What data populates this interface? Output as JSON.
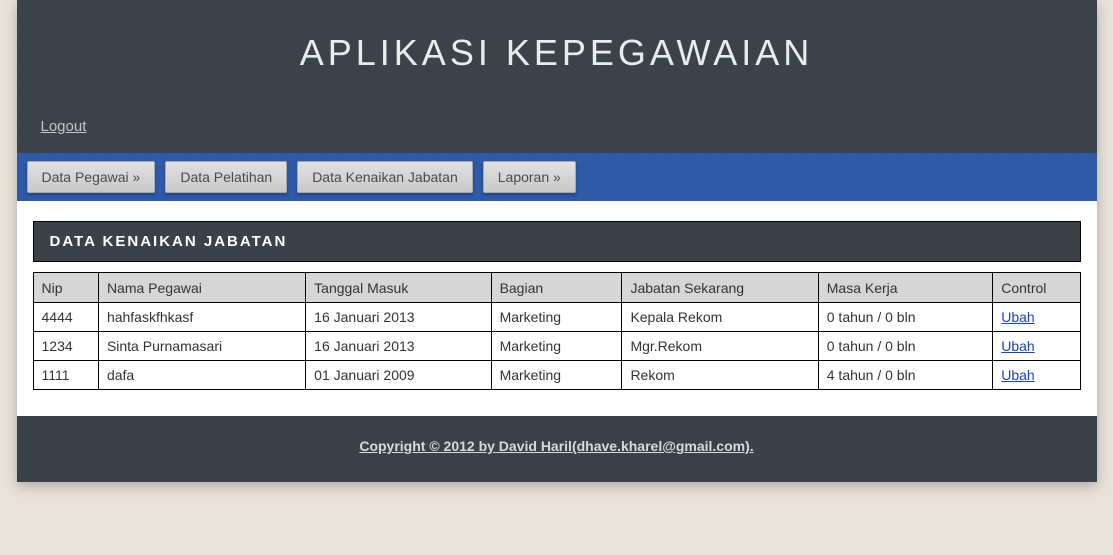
{
  "header": {
    "title": "APLIKASI KEPEGAWAIAN",
    "logout_label": "Logout"
  },
  "nav": {
    "items": [
      {
        "label": "Data Pegawai »"
      },
      {
        "label": "Data Pelatihan"
      },
      {
        "label": "Data Kenaikan Jabatan"
      },
      {
        "label": "Laporan »"
      }
    ]
  },
  "panel": {
    "title": "DATA KENAIKAN JABATAN"
  },
  "table": {
    "headers": {
      "nip": "Nip",
      "nama": "Nama Pegawai",
      "tgl": "Tanggal Masuk",
      "bagian": "Bagian",
      "jabatan": "Jabatan Sekarang",
      "masa": "Masa Kerja",
      "control": "Control"
    },
    "edit_label": "Ubah",
    "rows": [
      {
        "nip": "4444",
        "nama": "hahfaskfhkasf",
        "tgl": "16 Januari 2013",
        "bagian": "Marketing",
        "jabatan": "Kepala Rekom",
        "masa": "0 tahun / 0 bln"
      },
      {
        "nip": "1234",
        "nama": "Sinta Purnamasari",
        "tgl": "16 Januari 2013",
        "bagian": "Marketing",
        "jabatan": "Mgr.Rekom",
        "masa": "0 tahun / 0 bln"
      },
      {
        "nip": "1111",
        "nama": "dafa",
        "tgl": "01 Januari 2009",
        "bagian": "Marketing",
        "jabatan": "Rekom",
        "masa": "4 tahun / 0 bln"
      }
    ]
  },
  "footer": {
    "text": "Copyright © 2012 by David Haril(dhave.kharel@gmail.com)."
  }
}
